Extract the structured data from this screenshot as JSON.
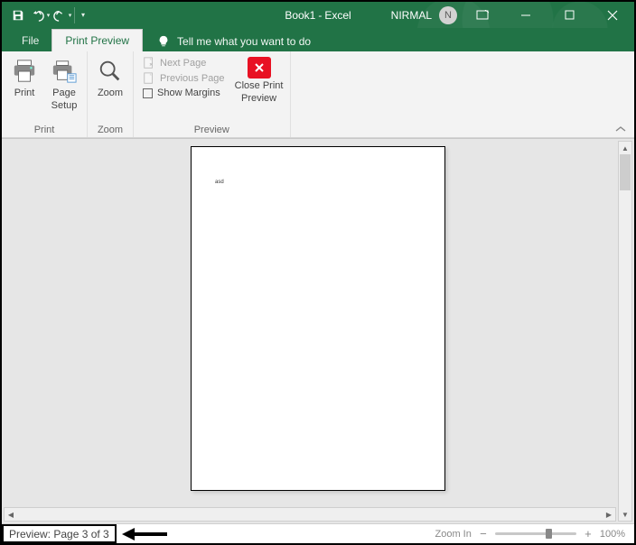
{
  "title": {
    "doc": "Book1",
    "sep": "-",
    "app": "Excel"
  },
  "user": {
    "name": "NIRMAL",
    "initial": "N"
  },
  "tabs": {
    "file": "File",
    "active": "Print Preview"
  },
  "tellme": "Tell me what you want to do",
  "ribbon": {
    "print_group": "Print",
    "zoom_group": "Zoom",
    "preview_group": "Preview",
    "print": "Print",
    "page_setup_l1": "Page",
    "page_setup_l2": "Setup",
    "zoom": "Zoom",
    "next_page": "Next Page",
    "previous_page": "Previous Page",
    "show_margins": "Show Margins",
    "close_l1": "Close Print",
    "close_l2": "Preview"
  },
  "page_content": "asd",
  "status": {
    "preview_text": "Preview: Page 3 of 3",
    "zoom_in": "Zoom In",
    "zoom_pct": "100%"
  }
}
